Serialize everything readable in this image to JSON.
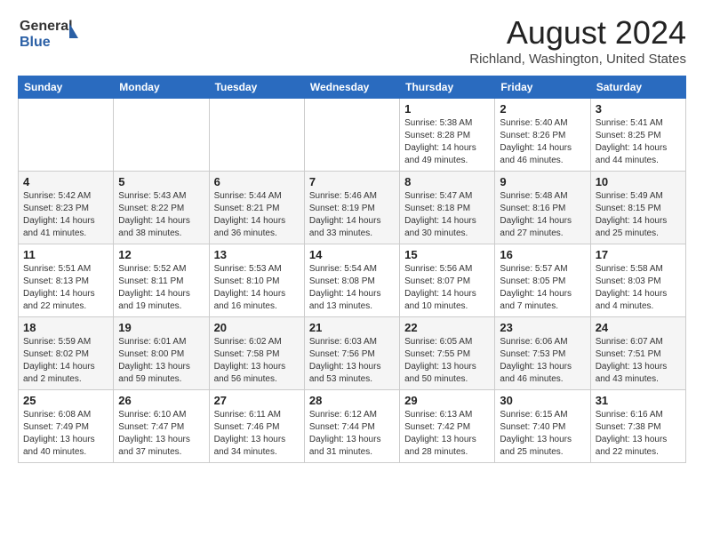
{
  "header": {
    "logo_general": "General",
    "logo_blue": "Blue",
    "month_title": "August 2024",
    "location": "Richland, Washington, United States"
  },
  "weekdays": [
    "Sunday",
    "Monday",
    "Tuesday",
    "Wednesday",
    "Thursday",
    "Friday",
    "Saturday"
  ],
  "weeks": [
    [
      {
        "day": "",
        "info": ""
      },
      {
        "day": "",
        "info": ""
      },
      {
        "day": "",
        "info": ""
      },
      {
        "day": "",
        "info": ""
      },
      {
        "day": "1",
        "info": "Sunrise: 5:38 AM\nSunset: 8:28 PM\nDaylight: 14 hours\nand 49 minutes."
      },
      {
        "day": "2",
        "info": "Sunrise: 5:40 AM\nSunset: 8:26 PM\nDaylight: 14 hours\nand 46 minutes."
      },
      {
        "day": "3",
        "info": "Sunrise: 5:41 AM\nSunset: 8:25 PM\nDaylight: 14 hours\nand 44 minutes."
      }
    ],
    [
      {
        "day": "4",
        "info": "Sunrise: 5:42 AM\nSunset: 8:23 PM\nDaylight: 14 hours\nand 41 minutes."
      },
      {
        "day": "5",
        "info": "Sunrise: 5:43 AM\nSunset: 8:22 PM\nDaylight: 14 hours\nand 38 minutes."
      },
      {
        "day": "6",
        "info": "Sunrise: 5:44 AM\nSunset: 8:21 PM\nDaylight: 14 hours\nand 36 minutes."
      },
      {
        "day": "7",
        "info": "Sunrise: 5:46 AM\nSunset: 8:19 PM\nDaylight: 14 hours\nand 33 minutes."
      },
      {
        "day": "8",
        "info": "Sunrise: 5:47 AM\nSunset: 8:18 PM\nDaylight: 14 hours\nand 30 minutes."
      },
      {
        "day": "9",
        "info": "Sunrise: 5:48 AM\nSunset: 8:16 PM\nDaylight: 14 hours\nand 27 minutes."
      },
      {
        "day": "10",
        "info": "Sunrise: 5:49 AM\nSunset: 8:15 PM\nDaylight: 14 hours\nand 25 minutes."
      }
    ],
    [
      {
        "day": "11",
        "info": "Sunrise: 5:51 AM\nSunset: 8:13 PM\nDaylight: 14 hours\nand 22 minutes."
      },
      {
        "day": "12",
        "info": "Sunrise: 5:52 AM\nSunset: 8:11 PM\nDaylight: 14 hours\nand 19 minutes."
      },
      {
        "day": "13",
        "info": "Sunrise: 5:53 AM\nSunset: 8:10 PM\nDaylight: 14 hours\nand 16 minutes."
      },
      {
        "day": "14",
        "info": "Sunrise: 5:54 AM\nSunset: 8:08 PM\nDaylight: 14 hours\nand 13 minutes."
      },
      {
        "day": "15",
        "info": "Sunrise: 5:56 AM\nSunset: 8:07 PM\nDaylight: 14 hours\nand 10 minutes."
      },
      {
        "day": "16",
        "info": "Sunrise: 5:57 AM\nSunset: 8:05 PM\nDaylight: 14 hours\nand 7 minutes."
      },
      {
        "day": "17",
        "info": "Sunrise: 5:58 AM\nSunset: 8:03 PM\nDaylight: 14 hours\nand 4 minutes."
      }
    ],
    [
      {
        "day": "18",
        "info": "Sunrise: 5:59 AM\nSunset: 8:02 PM\nDaylight: 14 hours\nand 2 minutes."
      },
      {
        "day": "19",
        "info": "Sunrise: 6:01 AM\nSunset: 8:00 PM\nDaylight: 13 hours\nand 59 minutes."
      },
      {
        "day": "20",
        "info": "Sunrise: 6:02 AM\nSunset: 7:58 PM\nDaylight: 13 hours\nand 56 minutes."
      },
      {
        "day": "21",
        "info": "Sunrise: 6:03 AM\nSunset: 7:56 PM\nDaylight: 13 hours\nand 53 minutes."
      },
      {
        "day": "22",
        "info": "Sunrise: 6:05 AM\nSunset: 7:55 PM\nDaylight: 13 hours\nand 50 minutes."
      },
      {
        "day": "23",
        "info": "Sunrise: 6:06 AM\nSunset: 7:53 PM\nDaylight: 13 hours\nand 46 minutes."
      },
      {
        "day": "24",
        "info": "Sunrise: 6:07 AM\nSunset: 7:51 PM\nDaylight: 13 hours\nand 43 minutes."
      }
    ],
    [
      {
        "day": "25",
        "info": "Sunrise: 6:08 AM\nSunset: 7:49 PM\nDaylight: 13 hours\nand 40 minutes."
      },
      {
        "day": "26",
        "info": "Sunrise: 6:10 AM\nSunset: 7:47 PM\nDaylight: 13 hours\nand 37 minutes."
      },
      {
        "day": "27",
        "info": "Sunrise: 6:11 AM\nSunset: 7:46 PM\nDaylight: 13 hours\nand 34 minutes."
      },
      {
        "day": "28",
        "info": "Sunrise: 6:12 AM\nSunset: 7:44 PM\nDaylight: 13 hours\nand 31 minutes."
      },
      {
        "day": "29",
        "info": "Sunrise: 6:13 AM\nSunset: 7:42 PM\nDaylight: 13 hours\nand 28 minutes."
      },
      {
        "day": "30",
        "info": "Sunrise: 6:15 AM\nSunset: 7:40 PM\nDaylight: 13 hours\nand 25 minutes."
      },
      {
        "day": "31",
        "info": "Sunrise: 6:16 AM\nSunset: 7:38 PM\nDaylight: 13 hours\nand 22 minutes."
      }
    ]
  ]
}
